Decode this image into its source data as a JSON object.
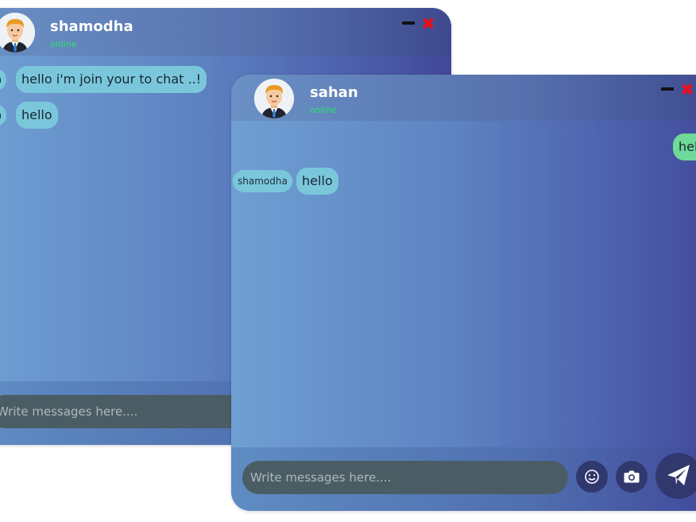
{
  "back_window": {
    "user_name": "shamodha",
    "status": "online",
    "messages": [
      {
        "sender": "sahan",
        "text": "hello i'm join your to chat ..!"
      },
      {
        "sender": "sahan",
        "text": "hello"
      }
    ],
    "input_placeholder": "Write messages here...."
  },
  "front_window": {
    "user_name": "sahan",
    "status": "online",
    "messages": [
      {
        "sender": "",
        "text": "hello",
        "mine": true
      },
      {
        "sender": "shamodha",
        "text": "hello"
      }
    ],
    "input_placeholder": "Write messages here...."
  },
  "colors": {
    "online": "#2be36b",
    "incoming_bubble": "#7ac7dc",
    "outgoing_bubble": "#6ed998",
    "close": "#e8111b",
    "button_bg": "#30386e"
  },
  "icons": [
    "user-avatar",
    "minimize-icon",
    "close-icon",
    "emoji-icon",
    "camera-icon",
    "send-icon"
  ]
}
